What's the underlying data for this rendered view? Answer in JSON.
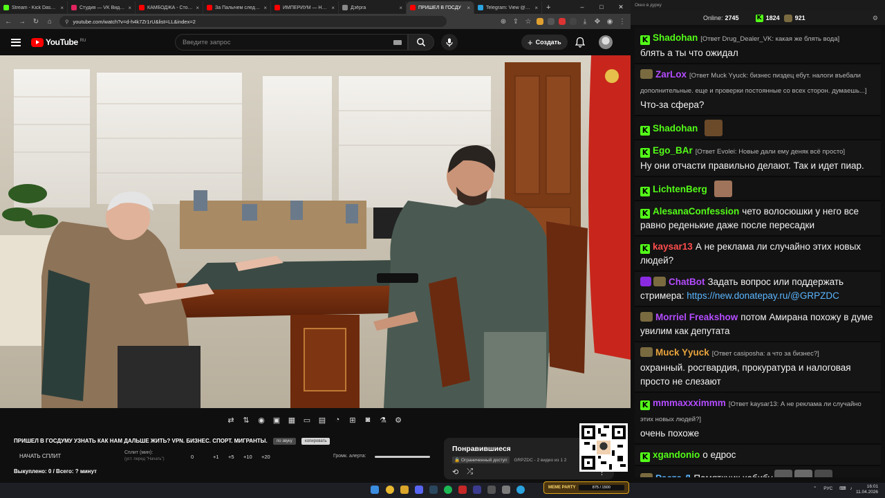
{
  "browser": {
    "tabs": [
      {
        "title": "Stream - Kick Dashboard",
        "color": "#53fc18"
      },
      {
        "title": "Студия — VK Видео Ли",
        "color": "#e0245e"
      },
      {
        "title": "КАМБОДЖА - Столица",
        "color": "#ff0000"
      },
      {
        "title": "За Палычем следят и р",
        "color": "#ff0000"
      },
      {
        "title": "ИМПЕРИУМ — НЕ РО",
        "color": "#ff0000"
      },
      {
        "title": "Дзёрга",
        "color": "#888888"
      },
      {
        "title": "ПРИШЕЛ В ГОСДУ",
        "color": "#ff0000",
        "active": true
      },
      {
        "title": "Telegram: View @dvach",
        "color": "#2aa3df"
      }
    ],
    "url": "youtube.com/watch?v=d-h4k7Zr1rU&list=LL&index=2",
    "window_buttons": [
      "–",
      "□",
      "✕"
    ]
  },
  "youtube": {
    "logo_word": "YouTube",
    "region": "RU",
    "search_placeholder": "Введите запрос",
    "create_label": "Создать",
    "video_title": "ПРИШЕЛ В ГОСДУМУ УЗНАТЬ КАК НАМ ДАЛЬШЕ ЖИТЬ? VPN. БИЗНЕС. СПОРТ. МИГРАНТЫ.",
    "pill_1": "по звуку",
    "pill_2": "копировать",
    "split_button": "НАЧАТЬ СПЛИТ",
    "split_label": "Сплит (мин):",
    "split_sub": "(уст. перед \"Начать\")",
    "split_values": [
      "0",
      "+1",
      "+5",
      "+10",
      "+20"
    ],
    "alert_label": "Громк. алерта:",
    "bought": "Выкуплено: 0 / Всего: ? минут",
    "liked_title": "Понравившиеся",
    "liked_access": "Ограниченный доступ",
    "liked_meta": "GRPZDC - 2 видео из 1 2",
    "controls": [
      "⇄",
      "⇅",
      "◉",
      "▣",
      "▦",
      "▭",
      "▤",
      "◔",
      "⊞",
      "◙",
      "⚗",
      "⚙"
    ]
  },
  "chat": {
    "window_title": "Окно в дурку",
    "online_label": "Online:",
    "online_count": "2745",
    "kick_count": "1824",
    "other_count": "921",
    "messages": [
      {
        "badge": "k",
        "name": "Shadohan",
        "color": "#53fc18",
        "reply": "[Ответ Drug_Dealer_VK: какая же блять вода]",
        "text": "блять а ты что ожидал"
      },
      {
        "badge": "o",
        "name": "ZarLox",
        "color": "#b44cff",
        "reply": "[Ответ Muck Yyuck: бизнес пиздец ебут. налоги въебали дополнительные. еще и проверки постоянные со всех сторон. думаешь...]",
        "text": "Что-за сфера?"
      },
      {
        "badge": "k",
        "name": "Shadohan",
        "color": "#53fc18",
        "reply": "",
        "text": "",
        "emote": "#6b4a2a"
      },
      {
        "badge": "k",
        "name": "Ego_BAr",
        "color": "#53fc18",
        "reply": "[Ответ Evolei: Новые дали ему деняк всё просто]",
        "text": "Ну они отчасти правильно делают. Так и идет пиар."
      },
      {
        "badge": "k",
        "name": "LichtenBerg",
        "color": "#53fc18",
        "reply": "",
        "text": "",
        "emote": "#a0745a"
      },
      {
        "badge": "k",
        "name": "AlesanaConfession",
        "color": "#53fc18",
        "reply": "",
        "text": "чето волосюшки у него все равно реденькие даже после пересадки"
      },
      {
        "badge": "k",
        "name": "kaysar13",
        "color": "#ff4d4d",
        "reply": "",
        "text": "А не реклама ли случайно этих новых людей?"
      },
      {
        "badge": "p",
        "name": "ChatBot",
        "color": "#b44cff",
        "reply": "",
        "text": "Задать вопрос или поддержать стримера: ",
        "link": "https://new.donatepay.ru/@GRPZDC"
      },
      {
        "badge": "o",
        "name": "Morriel Freakshow",
        "color": "#b44cff",
        "reply": "",
        "text": "потом Амирана похожу в думе увилим как депутата"
      },
      {
        "badge": "o",
        "name": "Muck Yyuck",
        "color": "#e8a33d",
        "reply": "[Ответ casiposha: а что за бизнес?]",
        "text": "охранный. росгвардия, прокуратура и налоговая просто не слезают"
      },
      {
        "badge": "k",
        "name": "mmmaxxximmm",
        "color": "#b44cff",
        "reply": "[Ответ kaysar13: А не реклама ли случайно этих новых людей?]",
        "text": "очень похоже"
      },
      {
        "badge": "k",
        "name": "xgandonio",
        "color": "#53fc18",
        "reply": "",
        "text": "о едрос"
      },
      {
        "badge": "o",
        "name": "Раста.Д",
        "color": "#5bb6ff",
        "reply": "",
        "text": "Памяткник хабибу",
        "emotes3": true
      }
    ]
  },
  "taskbar": {
    "meme_label": "MEME PARTY",
    "meme_progress": "875 / 1500",
    "tray_lang": "РУС",
    "time": "16:01",
    "date": "11.04.2026"
  }
}
